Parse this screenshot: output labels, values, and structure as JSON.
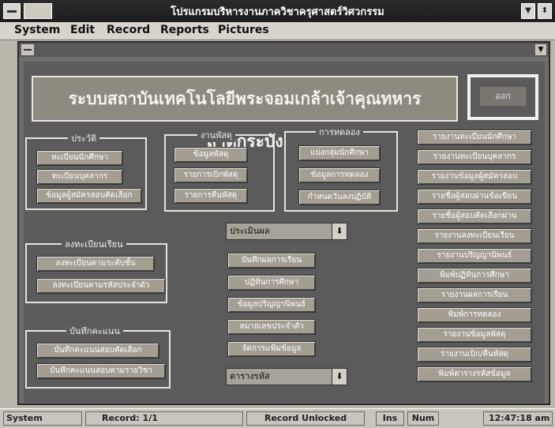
{
  "app": {
    "title": "โปรแกรมบริหารงานภาควิชาครุศาสตร์วิศวกรรม"
  },
  "menu": [
    "System",
    "Edit",
    "Record",
    "Reports",
    "Pictures"
  ],
  "banner": "ระบบสถาบันเทคโนโลยีพระจอมเกล้าเจ้าคุณทหารลาดกระบัง",
  "exit_label": "ออก",
  "groups": {
    "history": {
      "label": "ประวัติ",
      "items": [
        "ทะเบียนนักศึกษา",
        "ทะเบียนบุคลากร",
        "ข้อมูลผู้สมัครสอบคัดเลือก"
      ]
    },
    "supplies": {
      "label": "งานพัสดุ",
      "items": [
        "ข้อมูลพัสดุ",
        "รายการเบิกพัสดุ",
        "รายการคืนพัสดุ"
      ]
    },
    "experiment": {
      "label": "การทดลอง",
      "items": [
        "แบ่งกลุ่มนักศึกษา",
        "ข้อมูลการทดลอง",
        "กำหนดวันลงปฏิบัติ"
      ]
    },
    "registration": {
      "label": "ลงทะเบียนเรียน",
      "items": [
        "ลงทะเบียนตามระดับชั้น",
        "ลงทะเบียนตามรหัสประจำตัว"
      ]
    },
    "scores": {
      "label": "บันทึกคะแนน",
      "items": [
        "บันทึกคะแนนสอบคัดเลือก",
        "บันทึกคะแนนสอบตามรายวิชา"
      ]
    }
  },
  "center": {
    "combo1": "ประเมินผล",
    "items": [
      "บันทึกผลการเรียน",
      "ปฏิทินการศึกษา",
      "ข้อมูลปริญญานิพนธ์",
      "หมายเลขประจำตัว",
      "จัดการแฟ้มข้อมูล"
    ],
    "combo2": "ตารางรหัส"
  },
  "reports": [
    "รายงานทะเบียนนักศึกษา",
    "รายงานทะเบียนบุคลากร",
    "รายงานข้อมูลผู้สมัครสอบ",
    "รายชื่อผู้สอบผ่านข้อเขียน",
    "รายชื่อผู้สอบคัดเลือกผ่าน",
    "รายงานลงทะเบียนเรียน",
    "รายงานปริญญานิพนธ์",
    "พิมพ์ปฏิทินการศึกษา",
    "รายงานผลการเรียน",
    "พิมพ์การทดลอง",
    "รายงานข้อมูลพัสดุ",
    "รายงานเบิก/คืนพัสดุ",
    "พิมพ์ตารางรหัสข้อมูล"
  ],
  "status": {
    "mode": "System",
    "record": "Record: 1/1",
    "lock": "Record Unlocked",
    "ins": "Ins",
    "num": "Num",
    "time": "12:47:18 am"
  }
}
